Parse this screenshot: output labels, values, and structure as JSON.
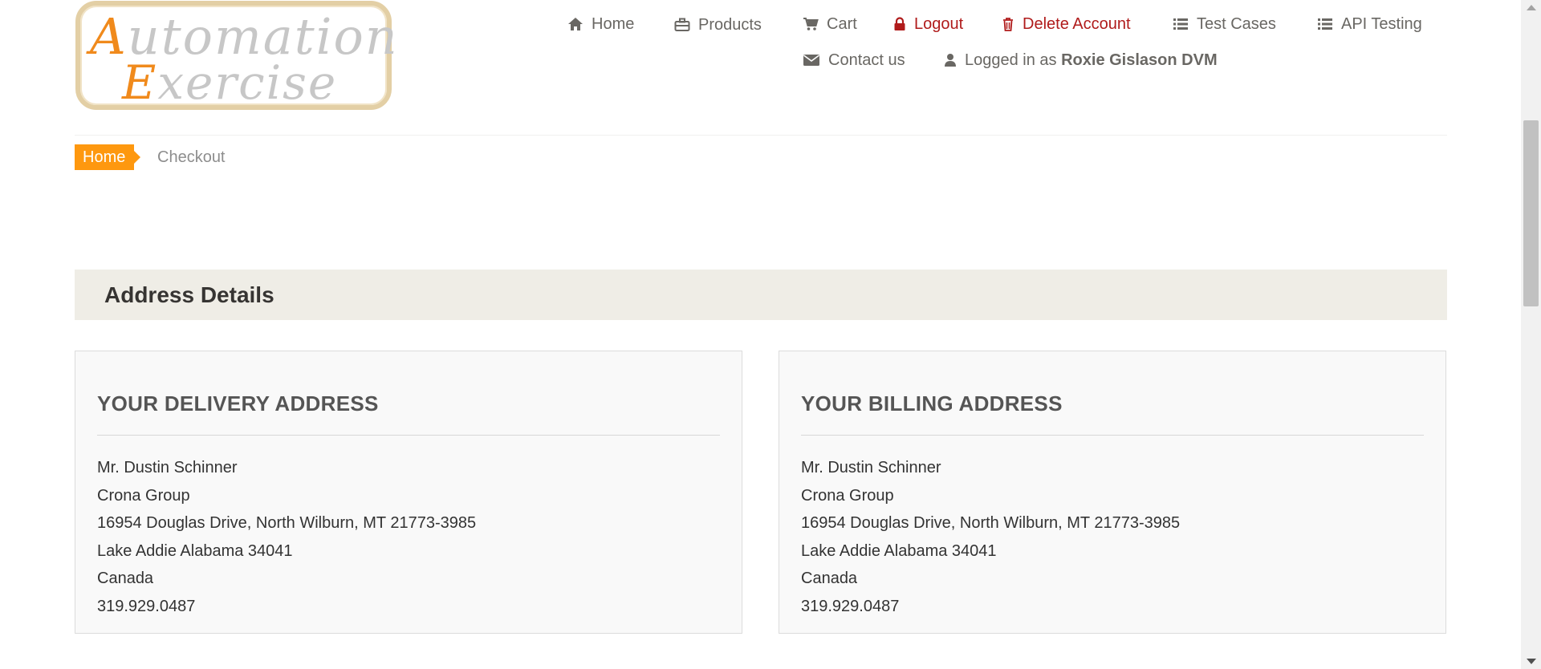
{
  "logo": {
    "line1_cap": "A",
    "line1_rest": "utomation",
    "line2_cap": "E",
    "line2_rest": "xercise"
  },
  "nav": {
    "home": "Home",
    "products": "Products",
    "cart": "Cart",
    "logout": "Logout",
    "delete_account": "Delete Account",
    "test_cases": "Test Cases",
    "api_testing": "API Testing",
    "contact_us": "Contact us",
    "logged_in_prefix": "Logged in as",
    "logged_in_user": "Roxie Gislason DVM"
  },
  "breadcrumb": {
    "home": "Home",
    "current": "Checkout"
  },
  "section": {
    "title": "Address Details"
  },
  "delivery": {
    "title": "YOUR DELIVERY ADDRESS",
    "lines": [
      "Mr. Dustin Schinner",
      "Crona Group",
      "16954 Douglas Drive, North Wilburn, MT 21773-3985",
      "Lake Addie Alabama 34041",
      "Canada",
      "319.929.0487"
    ]
  },
  "billing": {
    "title": "YOUR BILLING ADDRESS",
    "lines": [
      "Mr. Dustin Schinner",
      "Crona Group",
      "16954 Douglas Drive, North Wilburn, MT 21773-3985",
      "Lake Addie Alabama 34041",
      "Canada",
      "319.929.0487"
    ]
  },
  "colors": {
    "accent": "#fe980f",
    "danger": "#b01b1b",
    "nav_text": "#696763",
    "section_bg": "#efede6"
  },
  "icons": {
    "home": "home-icon",
    "products": "briefcase-icon",
    "cart": "cart-icon",
    "logout": "lock-icon",
    "delete": "trash-icon",
    "test_cases": "list-icon",
    "api_testing": "list-icon",
    "contact": "envelope-icon",
    "user": "user-icon"
  }
}
